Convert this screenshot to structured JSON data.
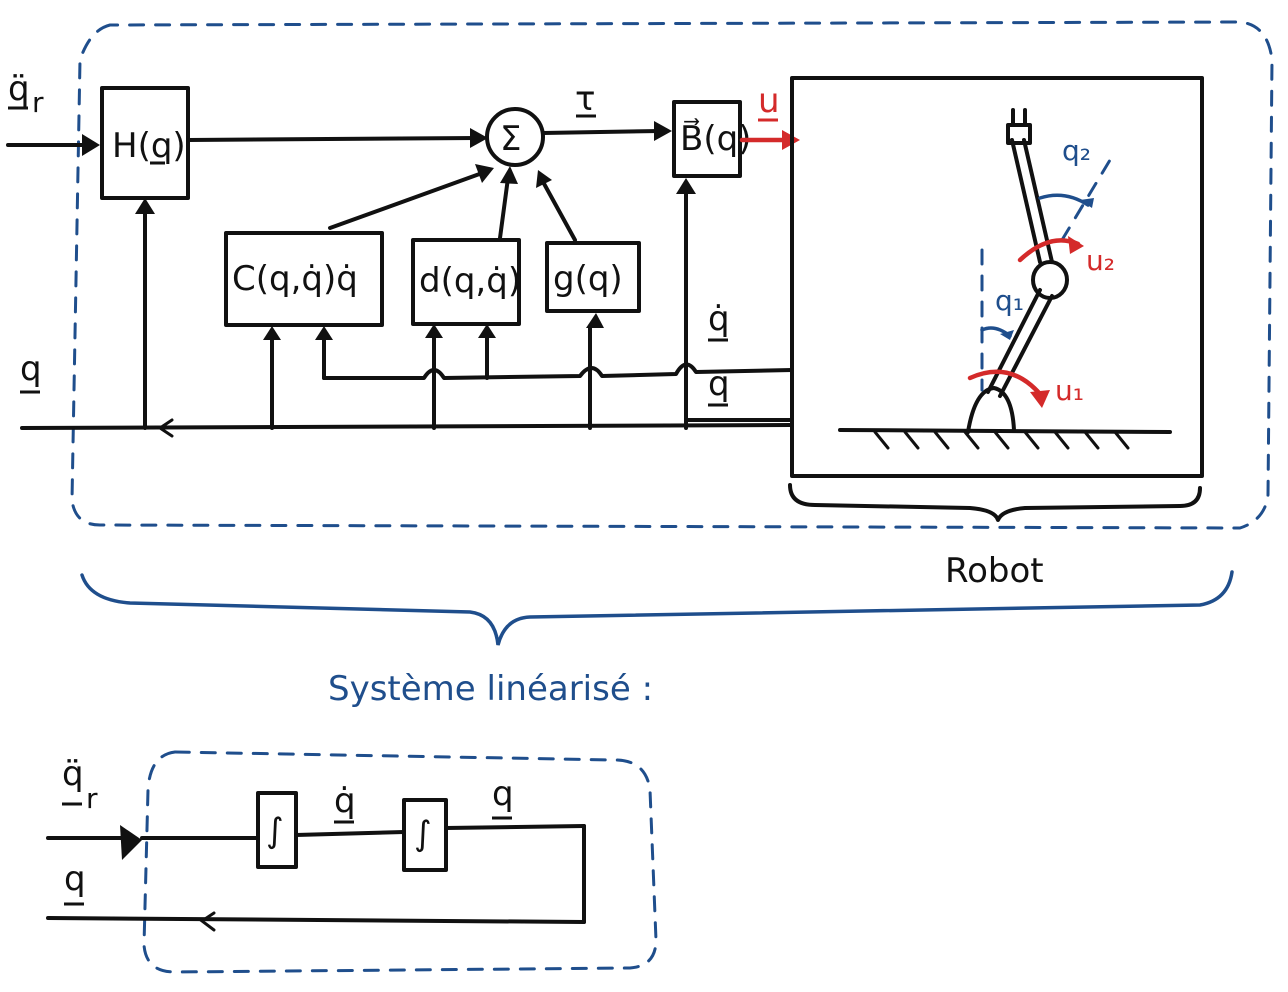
{
  "labels": {
    "input_accel": "q̈",
    "input_accel_sub": "r",
    "q_left": "q",
    "block_H": "H(q)",
    "block_C": "C(q,q̇)q̇",
    "block_d": "d(q,q̇)",
    "block_g": "g(q)",
    "block_sum": "Σ",
    "block_B": "B⃗(q)",
    "signal_tau": "τ",
    "signal_u": "u",
    "signal_qdot": "q̇",
    "signal_q": "q",
    "robot_q1": "q₁",
    "robot_q2": "q₂",
    "robot_u1": "u₁",
    "robot_u2": "u₂",
    "robot_caption": "Robot",
    "linearized_caption": "Système linéarisé :",
    "lin_input_accel": "q̈",
    "lin_input_sub": "r",
    "lin_q_left": "q",
    "lin_int1": "∫",
    "lin_int2": "∫",
    "lin_qdot": "q̇",
    "lin_q": "q"
  },
  "colors": {
    "ink": "#111111",
    "blue": "#1f4e8c",
    "red": "#d42a2a"
  }
}
